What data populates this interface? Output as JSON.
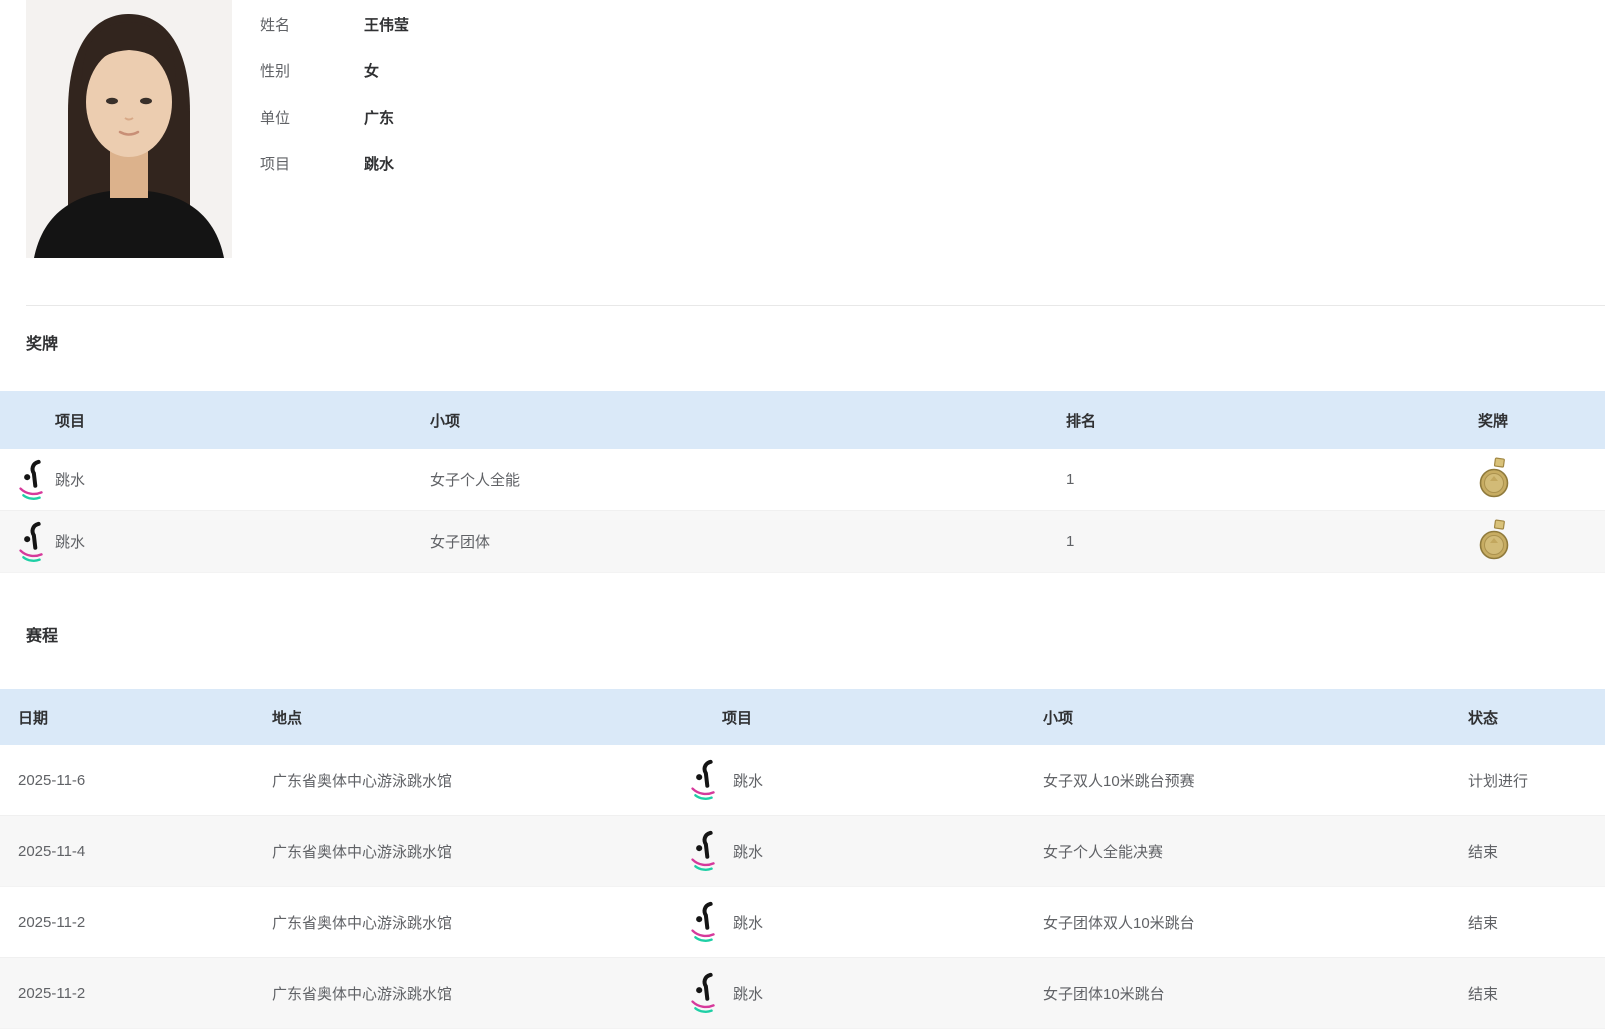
{
  "profile": {
    "photo_alt": "athlete-portrait",
    "fields": [
      {
        "label": "姓名",
        "value": "王伟莹"
      },
      {
        "label": "性别",
        "value": "女"
      },
      {
        "label": "单位",
        "value": "广东"
      },
      {
        "label": "项目",
        "value": "跳水"
      }
    ]
  },
  "medals_section": {
    "title": "奖牌",
    "columns": [
      "项目",
      "小项",
      "排名",
      "奖牌"
    ],
    "rows": [
      {
        "event": "跳水",
        "sub_event": "女子个人全能",
        "rank": "1",
        "medal": "gold"
      },
      {
        "event": "跳水",
        "sub_event": "女子团体",
        "rank": "1",
        "medal": "gold"
      }
    ]
  },
  "schedule_section": {
    "title": "赛程",
    "columns": [
      "日期",
      "地点",
      "项目",
      "小项",
      "状态"
    ],
    "rows": [
      {
        "date": "2025-11-6",
        "venue": "广东省奥体中心游泳跳水馆",
        "event": "跳水",
        "sub_event": "女子双人10米跳台预赛",
        "status": "计划进行"
      },
      {
        "date": "2025-11-4",
        "venue": "广东省奥体中心游泳跳水馆",
        "event": "跳水",
        "sub_event": "女子个人全能决赛",
        "status": "结束"
      },
      {
        "date": "2025-11-2",
        "venue": "广东省奥体中心游泳跳水馆",
        "event": "跳水",
        "sub_event": "女子团体双人10米跳台",
        "status": "结束"
      },
      {
        "date": "2025-11-2",
        "venue": "广东省奥体中心游泳跳水馆",
        "event": "跳水",
        "sub_event": "女子团体10米跳台",
        "status": "结束"
      }
    ]
  },
  "colors": {
    "table_header_bg": "#dae9f8",
    "row_alt_bg": "#f7f7f7",
    "divider": "#e8e8e8",
    "heading_text": "#303133",
    "cell_text": "#606266",
    "medal_gold": "#c7ac62",
    "icon_magenta": "#d6399b",
    "icon_teal": "#1ecfa5"
  },
  "icons": {
    "diving": "diving-pictogram",
    "gold_medal": "gold-medal"
  }
}
